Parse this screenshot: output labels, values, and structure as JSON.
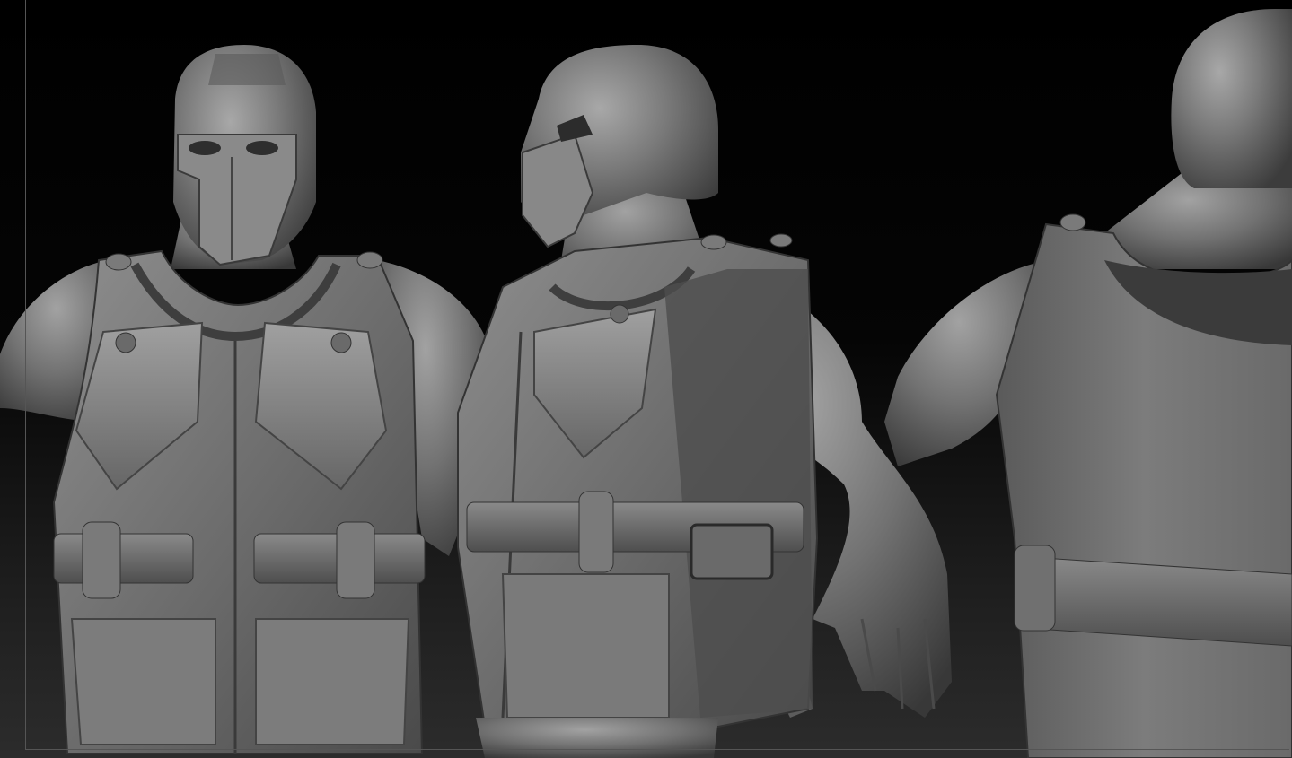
{
  "viewport": {
    "background_top": "#000000",
    "background_bottom": "#2c2c2c",
    "frame_color": "#555555"
  },
  "material": {
    "base": "#6e6e6e",
    "light": "#9a9a9a",
    "highlight": "#cfcfcf",
    "shadow": "#3a3a3a",
    "deep_shadow": "#262626"
  },
  "views": [
    "front-view",
    "three-quarter-view",
    "back-view"
  ]
}
